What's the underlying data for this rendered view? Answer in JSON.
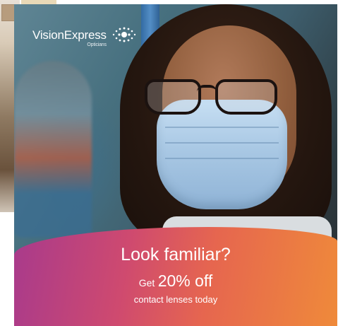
{
  "brand": {
    "name": "VisionExpress",
    "sub": "Opticians",
    "logo_icon": "eye-dots-icon"
  },
  "ad": {
    "headline": "Look familiar?",
    "offer_prefix": "Get",
    "offer_value": "20% off",
    "offer_detail": "contact lenses today"
  },
  "colors": {
    "banner_start": "#a83a8c",
    "banner_mid": "#e6664f",
    "banner_end": "#ef8a3a",
    "text": "#ffffff"
  }
}
